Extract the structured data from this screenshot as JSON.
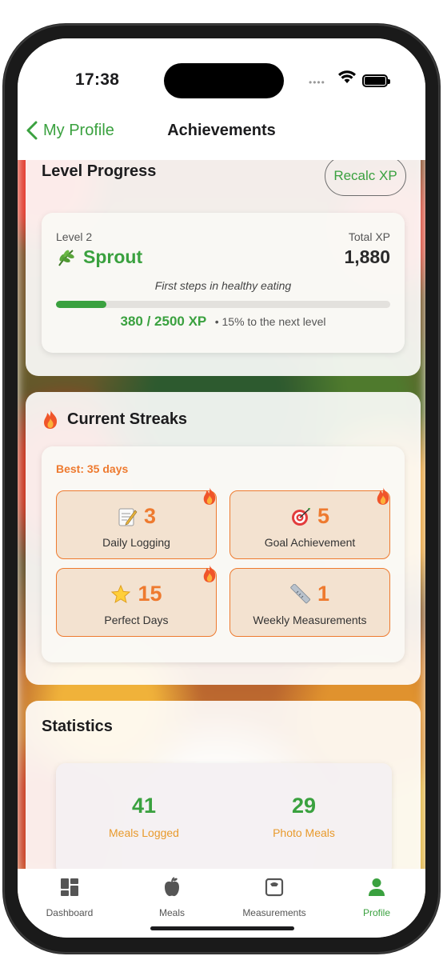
{
  "status_bar": {
    "time": "17:38"
  },
  "nav": {
    "back_label": "My Profile",
    "title": "Achievements"
  },
  "level_progress": {
    "title": "Level Progress",
    "recalc_label": "Recalc XP",
    "level_label": "Level 2",
    "level_name": "Sprout",
    "level_icon": "herb-leaf-icon",
    "total_xp_label": "Total XP",
    "total_xp_value": "1,880",
    "tagline": "First steps in healthy eating",
    "progress_value": "380 / 2500 XP",
    "progress_note": "• 15% to the next level",
    "progress_fraction": 0.15
  },
  "streaks": {
    "title": "Current Streaks",
    "title_icon": "fire-icon",
    "best": "Best: 35 days",
    "items": [
      {
        "icon": "memo-icon",
        "value": "3",
        "label": "Daily Logging",
        "fire": true
      },
      {
        "icon": "target-icon",
        "value": "5",
        "label": "Goal Achievement",
        "fire": true
      },
      {
        "icon": "star-icon",
        "value": "15",
        "label": "Perfect Days",
        "fire": true
      },
      {
        "icon": "ruler-icon",
        "value": "1",
        "label": "Weekly Measurements",
        "fire": false
      }
    ]
  },
  "statistics": {
    "title": "Statistics",
    "items": [
      {
        "value": "41",
        "label": "Meals Logged"
      },
      {
        "value": "29",
        "label": "Photo Meals"
      }
    ]
  },
  "tabbar": {
    "items": [
      {
        "label": "Dashboard",
        "icon": "dashboard-icon",
        "active": false
      },
      {
        "label": "Meals",
        "icon": "apple-icon",
        "active": false
      },
      {
        "label": "Measurements",
        "icon": "scale-icon",
        "active": false
      },
      {
        "label": "Profile",
        "icon": "person-icon",
        "active": true
      }
    ]
  },
  "colors": {
    "accent_green": "#3aa13f",
    "streak_orange": "#ee7a2f",
    "stat_label_orange": "#e89a2c"
  }
}
